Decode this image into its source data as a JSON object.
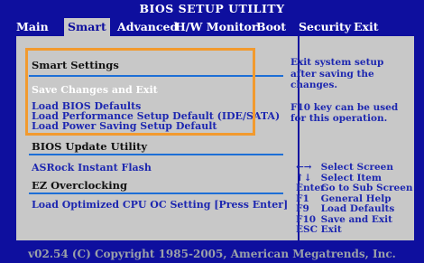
{
  "app": {
    "title": "BIOS SETUP UTILITY"
  },
  "menu": {
    "tabs": [
      {
        "label": "Main"
      },
      {
        "label": "Smart"
      },
      {
        "label": "Advanced"
      },
      {
        "label": "H/W Monitor"
      },
      {
        "label": "Boot"
      },
      {
        "label": "Security"
      },
      {
        "label": "Exit"
      }
    ],
    "active": "Smart"
  },
  "left": {
    "smart_settings": "Smart Settings",
    "save_changes": "Save Changes and Exit",
    "load_bios_defaults": "Load BIOS Defaults",
    "load_perf_default": "Load Performance Setup Default (IDE/SATA)",
    "load_power_saving": "Load Power Saving Setup Default",
    "bios_update": "BIOS Update Utility",
    "instant_flash": "ASRock Instant Flash",
    "ez_overclocking": "EZ Overclocking",
    "load_optimized": "Load Optimized CPU OC Setting  [Press Enter]"
  },
  "help": {
    "line1": "Exit system setup",
    "line2": "after saving the",
    "line3": "changes.",
    "line4": "F10 key can be used",
    "line5": "for this operation."
  },
  "keys": [
    {
      "key": "←→",
      "desc": "Select Screen"
    },
    {
      "key": "↑↓",
      "desc": "Select Item"
    },
    {
      "key": "Enter",
      "desc": "Go to Sub Screen"
    },
    {
      "key": "F1",
      "desc": "General Help"
    },
    {
      "key": "F9",
      "desc": "Load Defaults"
    },
    {
      "key": "F10",
      "desc": "Save and Exit"
    },
    {
      "key": "ESC",
      "desc": "Exit"
    }
  ],
  "footer": {
    "text": "v02.54 (C) Copyright 1985-2005, American Megatrends, Inc."
  },
  "colors": {
    "background": "#0e0f9e",
    "panel": "#c8c8c8",
    "selected_text": "#ffffff",
    "item_text": "#1d27b0",
    "highlight_box": "#f29a2e"
  }
}
